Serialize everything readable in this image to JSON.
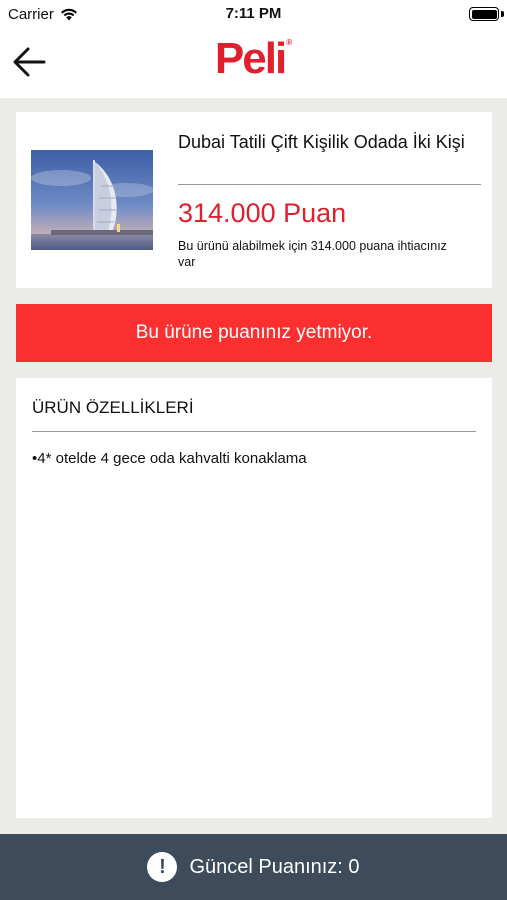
{
  "status_bar": {
    "carrier": "Carrier",
    "time": "7:11 PM"
  },
  "header": {
    "logo_text": "Peli",
    "logo_mark": "®"
  },
  "product": {
    "title": "Dubai Tatili Çift Kişilik Odada İki Kişi",
    "price": "314.000 Puan",
    "note": "Bu ürünü alabilmek için 314.000 puana ihtiacınız var"
  },
  "alert": {
    "message": "Bu ürüne puanınız yetmiyor."
  },
  "features": {
    "heading": "ÜRÜN ÖZELLİKLERİ",
    "items": [
      "•4* otelde 4 gece oda kahvalti konaklama"
    ]
  },
  "footer": {
    "icon": "!",
    "label": "Güncel Puanınız: 0"
  },
  "colors": {
    "brand_red": "#e0202c",
    "alert_red": "#fb2f2f",
    "footer_bg": "#3d4b5b"
  }
}
